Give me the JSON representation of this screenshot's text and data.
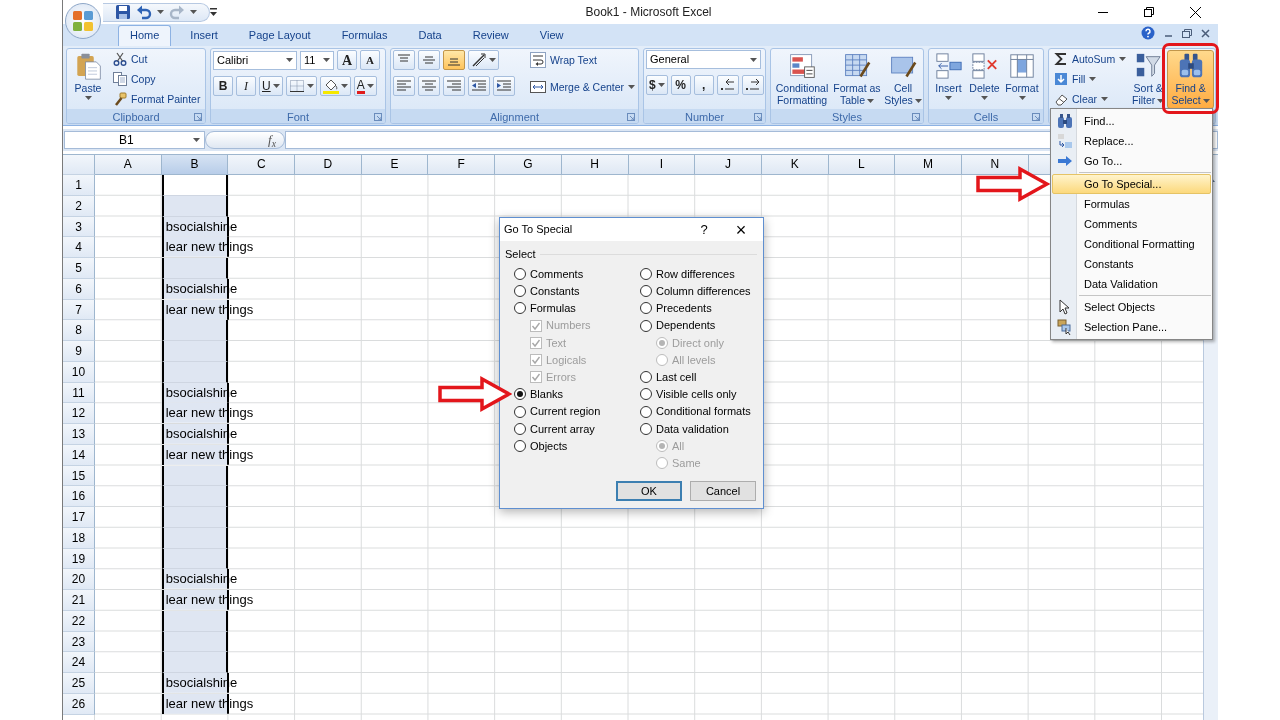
{
  "window": {
    "title": "Book1 - Microsoft Excel"
  },
  "tabs": [
    {
      "label": "Home",
      "selected": true
    },
    {
      "label": "Insert",
      "selected": false
    },
    {
      "label": "Page Layout",
      "selected": false
    },
    {
      "label": "Formulas",
      "selected": false
    },
    {
      "label": "Data",
      "selected": false
    },
    {
      "label": "Review",
      "selected": false
    },
    {
      "label": "View",
      "selected": false
    }
  ],
  "ribbon": [
    {
      "kind": "clipboard",
      "label": "Clipboard",
      "paste": "Paste",
      "items": [
        "Cut",
        "Copy",
        "Format Painter"
      ]
    },
    {
      "kind": "font",
      "label": "Font",
      "font_name": "Calibri",
      "font_size": "11",
      "grow": "A",
      "shrink": "A",
      "bold": "B",
      "italic": "I",
      "underline": "U",
      "font_color": "A"
    },
    {
      "kind": "alignment",
      "label": "Alignment",
      "vertical": [
        {
          "selected": false
        },
        {
          "selected": false
        },
        {
          "selected": true
        }
      ],
      "items": [
        "Wrap Text",
        "Merge & Center"
      ]
    },
    {
      "kind": "number",
      "label": "Number",
      "format": "General",
      "currency": "$",
      "percent": "%",
      "comma": ","
    },
    {
      "kind": "styles",
      "label": "Styles",
      "buttons": [
        "Conditional Formatting",
        "Format as Table",
        "Cell Styles"
      ]
    },
    {
      "kind": "cells",
      "label": "Cells",
      "buttons": [
        "Insert",
        "Delete",
        "Format"
      ]
    },
    {
      "kind": "editing",
      "items": [
        "AutoSum",
        "Fill",
        "Clear"
      ],
      "buttons": [
        {
          "label": "Sort & Filter",
          "pressed": false
        },
        {
          "label": "Find & Select",
          "pressed": true,
          "highlight": true
        }
      ]
    }
  ],
  "formula_bar": {
    "name_box": "B1",
    "function_label": "f$_{x}$"
  },
  "sheet": {
    "columns": [
      {
        "label": "A",
        "selected": false
      },
      {
        "label": "B",
        "selected": true
      },
      {
        "label": "C",
        "selected": false
      },
      {
        "label": "D",
        "selected": false
      },
      {
        "label": "E",
        "selected": false
      },
      {
        "label": "F",
        "selected": false
      },
      {
        "label": "G",
        "selected": false
      },
      {
        "label": "H",
        "selected": false
      },
      {
        "label": "I",
        "selected": false
      },
      {
        "label": "J",
        "selected": false
      },
      {
        "label": "K",
        "selected": false
      },
      {
        "label": "L",
        "selected": false
      },
      {
        "label": "M",
        "selected": false
      },
      {
        "label": "N",
        "selected": false
      }
    ],
    "rows": [
      {
        "label": "1",
        "active": true
      },
      {
        "label": "2",
        "active": false
      },
      {
        "label": "3",
        "active": false,
        "b": "bsocialshine"
      },
      {
        "label": "4",
        "active": false,
        "b": "lear new things"
      },
      {
        "label": "5",
        "active": false
      },
      {
        "label": "6",
        "active": false,
        "b": "bsocialshine"
      },
      {
        "label": "7",
        "active": false,
        "b": "lear new things"
      },
      {
        "label": "8",
        "active": false
      },
      {
        "label": "9",
        "active": false
      },
      {
        "label": "10",
        "active": false
      },
      {
        "label": "11",
        "active": false,
        "b": "bsocialshine"
      },
      {
        "label": "12",
        "active": false,
        "b": "lear new things"
      },
      {
        "label": "13",
        "active": false,
        "b": "bsocialshine"
      },
      {
        "label": "14",
        "active": false,
        "b": "lear new things"
      },
      {
        "label": "15",
        "active": false
      },
      {
        "label": "16",
        "active": false
      },
      {
        "label": "17",
        "active": false
      },
      {
        "label": "18",
        "active": false
      },
      {
        "label": "19",
        "active": false
      },
      {
        "label": "20",
        "active": false,
        "b": "bsocialshine"
      },
      {
        "label": "21",
        "active": false,
        "b": "lear new things"
      },
      {
        "label": "22",
        "active": false
      },
      {
        "label": "23",
        "active": false
      },
      {
        "label": "24",
        "active": false
      },
      {
        "label": "25",
        "active": false,
        "b": "bsocialshine"
      },
      {
        "label": "26",
        "active": false,
        "b": "lear new things"
      }
    ]
  },
  "dialog": {
    "title": "Go To Special",
    "help": "?",
    "close": "×",
    "section": "Select",
    "left_options": [
      {
        "label": "Comments",
        "kind": "radio",
        "selected": false,
        "disabled": false
      },
      {
        "label": "Constants",
        "kind": "radio",
        "selected": false,
        "disabled": false
      },
      {
        "label": "Formulas",
        "kind": "radio",
        "selected": false,
        "disabled": false,
        "children": [
          {
            "label": "Numbers",
            "kind": "checkbox",
            "checked": true,
            "disabled": true
          },
          {
            "label": "Text",
            "kind": "checkbox",
            "checked": true,
            "disabled": true
          },
          {
            "label": "Logicals",
            "kind": "checkbox",
            "checked": true,
            "disabled": true
          },
          {
            "label": "Errors",
            "kind": "checkbox",
            "checked": true,
            "disabled": true
          }
        ]
      },
      {
        "label": "Blanks",
        "kind": "radio",
        "selected": true,
        "disabled": false,
        "arrow": true
      },
      {
        "label": "Current region",
        "kind": "radio",
        "selected": false,
        "disabled": false
      },
      {
        "label": "Current array",
        "kind": "radio",
        "selected": false,
        "disabled": false
      },
      {
        "label": "Objects",
        "kind": "radio",
        "selected": false,
        "disabled": false
      }
    ],
    "right_options": [
      {
        "label": "Row differences",
        "kind": "radio",
        "selected": false,
        "disabled": false
      },
      {
        "label": "Column differences",
        "kind": "radio",
        "selected": false,
        "disabled": false
      },
      {
        "label": "Precedents",
        "kind": "radio",
        "selected": false,
        "disabled": false
      },
      {
        "label": "Dependents",
        "kind": "radio",
        "selected": false,
        "disabled": false,
        "children": [
          {
            "label": "Direct only",
            "kind": "radio",
            "selected": true,
            "disabled": true
          },
          {
            "label": "All levels",
            "kind": "radio",
            "selected": false,
            "disabled": true
          }
        ]
      },
      {
        "label": "Last cell",
        "kind": "radio",
        "selected": false,
        "disabled": false
      },
      {
        "label": "Visible cells only",
        "kind": "radio",
        "selected": false,
        "disabled": false
      },
      {
        "label": "Conditional formats",
        "kind": "radio",
        "selected": false,
        "disabled": false
      },
      {
        "label": "Data validation",
        "kind": "radio",
        "selected": false,
        "disabled": false,
        "children": [
          {
            "label": "All",
            "kind": "radio",
            "selected": true,
            "disabled": true
          },
          {
            "label": "Same",
            "kind": "radio",
            "selected": false,
            "disabled": true
          }
        ]
      }
    ],
    "buttons": [
      {
        "label": "OK",
        "default": true
      },
      {
        "label": "Cancel",
        "default": false
      }
    ]
  },
  "menu": {
    "sections": [
      [
        {
          "label": "Find...",
          "kind": "find",
          "selected": false
        },
        {
          "label": "Replace...",
          "kind": "replace",
          "selected": false
        },
        {
          "label": "Go To...",
          "kind": "goto",
          "selected": false
        }
      ],
      [
        {
          "label": "Go To Special...",
          "kind": "text",
          "selected": true,
          "arrow": true
        },
        {
          "label": "Formulas",
          "kind": "text",
          "selected": false
        },
        {
          "label": "Comments",
          "kind": "text",
          "selected": false
        },
        {
          "label": "Conditional Formatting",
          "kind": "text",
          "selected": false
        },
        {
          "label": "Constants",
          "kind": "text",
          "selected": false
        },
        {
          "label": "Data Validation",
          "kind": "text",
          "selected": false
        }
      ],
      [
        {
          "label": "Select Objects",
          "kind": "select",
          "selected": false
        },
        {
          "label": "Selection Pane...",
          "kind": "pane",
          "selected": false
        }
      ]
    ]
  }
}
